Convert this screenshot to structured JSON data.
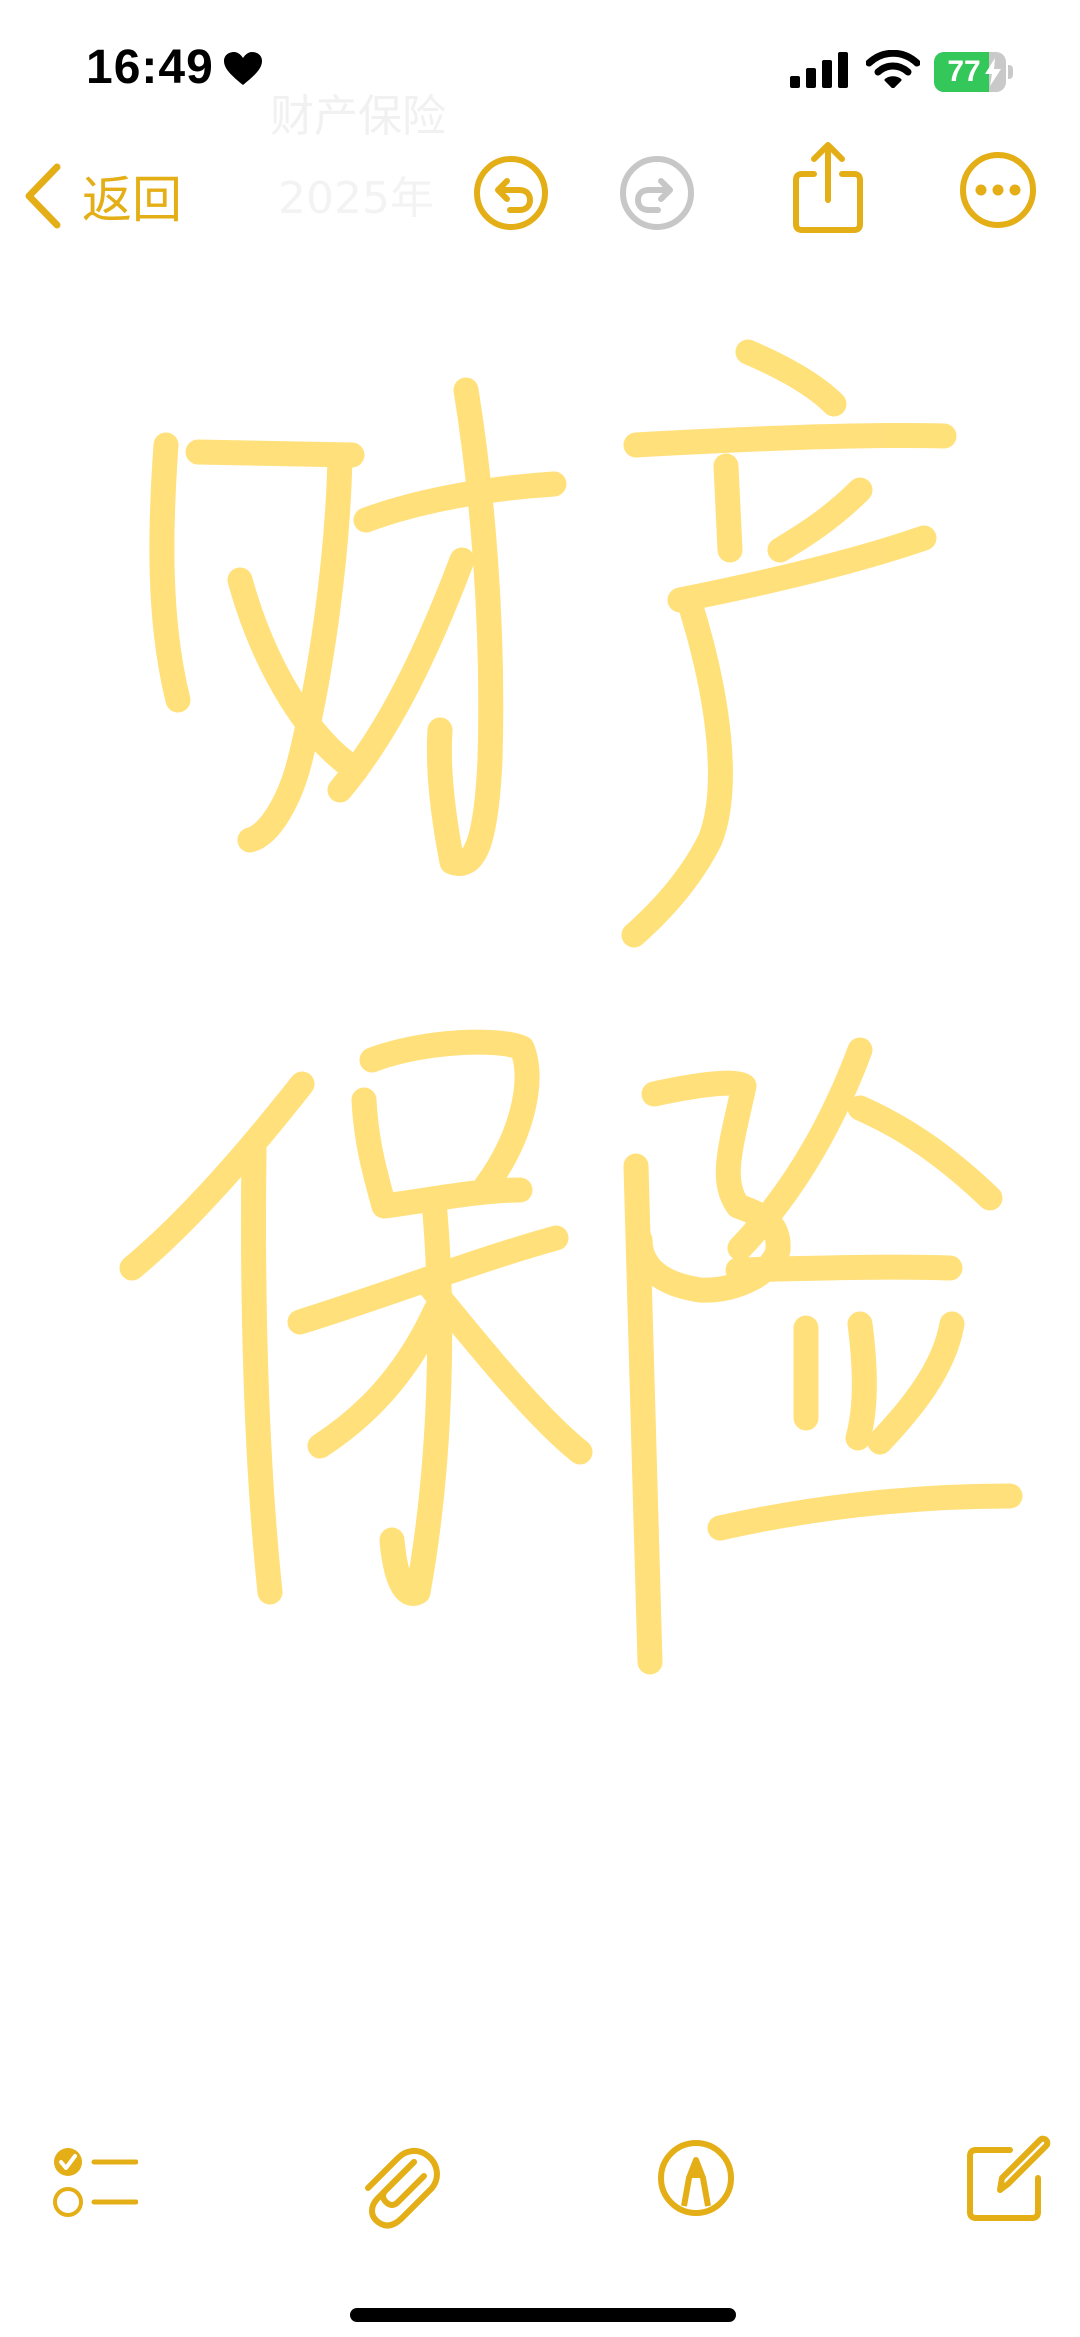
{
  "status_bar": {
    "time": "16:49",
    "battery_level": "77",
    "icons": [
      "heart-icon",
      "signal-icon",
      "wifi-icon",
      "battery-icon"
    ]
  },
  "nav": {
    "back_label": "返回",
    "icons": [
      "chevron-left-icon",
      "undo-icon",
      "redo-icon",
      "share-icon",
      "more-icon"
    ],
    "redo_enabled": false
  },
  "note": {
    "faded_title": "财产保险",
    "faded_date": "2025年",
    "drawing_text": "财产保险"
  },
  "toolbar": {
    "icons": [
      "checklist-icon",
      "attachment-icon",
      "markup-pen-icon",
      "compose-icon"
    ]
  },
  "colors": {
    "accent": "#e4ae16",
    "ink": "#ffdf73",
    "redo_disabled": "#c7c7c7",
    "battery_green": "#34c759"
  }
}
